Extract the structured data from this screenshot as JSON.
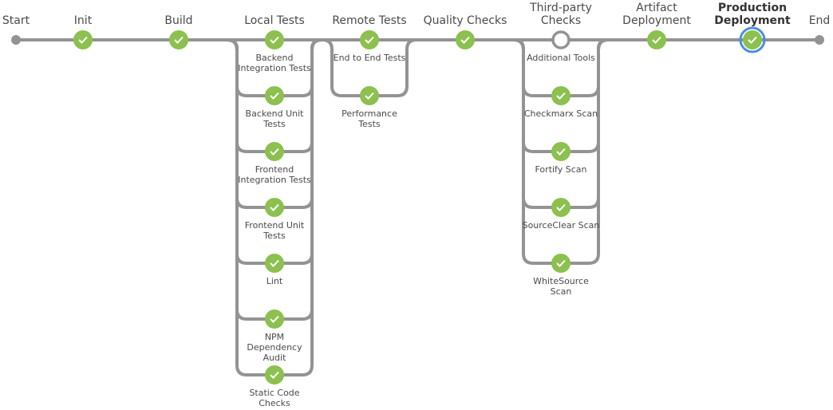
{
  "colors": {
    "line": "#949393",
    "success": "#8cc04f",
    "selected_ring": "#4a90d9",
    "terminal": "#949393",
    "text": "#4a4a4a"
  },
  "pipeline": {
    "start_label": "Start",
    "end_label": "End",
    "stages": [
      {
        "name": [
          "Init"
        ],
        "status": "success",
        "branches": []
      },
      {
        "name": [
          "Build"
        ],
        "status": "success",
        "branches": []
      },
      {
        "name": [
          "Local Tests"
        ],
        "status": "success",
        "branches": [
          {
            "name": [
              "Backend",
              "Integration Tests"
            ],
            "status": "success"
          },
          {
            "name": [
              "Backend Unit",
              "Tests"
            ],
            "status": "success"
          },
          {
            "name": [
              "Frontend",
              "Integration Tests"
            ],
            "status": "success"
          },
          {
            "name": [
              "Frontend Unit",
              "Tests"
            ],
            "status": "success"
          },
          {
            "name": [
              "Lint"
            ],
            "status": "success"
          },
          {
            "name": [
              "NPM",
              "Dependency",
              "Audit"
            ],
            "status": "success"
          },
          {
            "name": [
              "Static Code",
              "Checks"
            ],
            "status": "success"
          }
        ]
      },
      {
        "name": [
          "Remote Tests"
        ],
        "status": "success",
        "branches": [
          {
            "name": [
              "End to End Tests"
            ],
            "status": "success"
          },
          {
            "name": [
              "Performance",
              "Tests"
            ],
            "status": "success"
          }
        ]
      },
      {
        "name": [
          "Quality Checks"
        ],
        "status": "success",
        "branches": []
      },
      {
        "name": [
          "Third-party",
          "Checks"
        ],
        "status": "not_built",
        "branches": [
          {
            "name": [
              "Additional Tools"
            ],
            "status": "not_built"
          },
          {
            "name": [
              "Checkmarx Scan"
            ],
            "status": "success"
          },
          {
            "name": [
              "Fortify Scan"
            ],
            "status": "success"
          },
          {
            "name": [
              "SourceClear Scan"
            ],
            "status": "success"
          },
          {
            "name": [
              "WhiteSource",
              "Scan"
            ],
            "status": "success"
          }
        ]
      },
      {
        "name": [
          "Artifact",
          "Deployment"
        ],
        "status": "success",
        "branches": []
      },
      {
        "name": [
          "Production",
          "Deployment"
        ],
        "status": "success",
        "selected": true,
        "branches": []
      }
    ]
  }
}
